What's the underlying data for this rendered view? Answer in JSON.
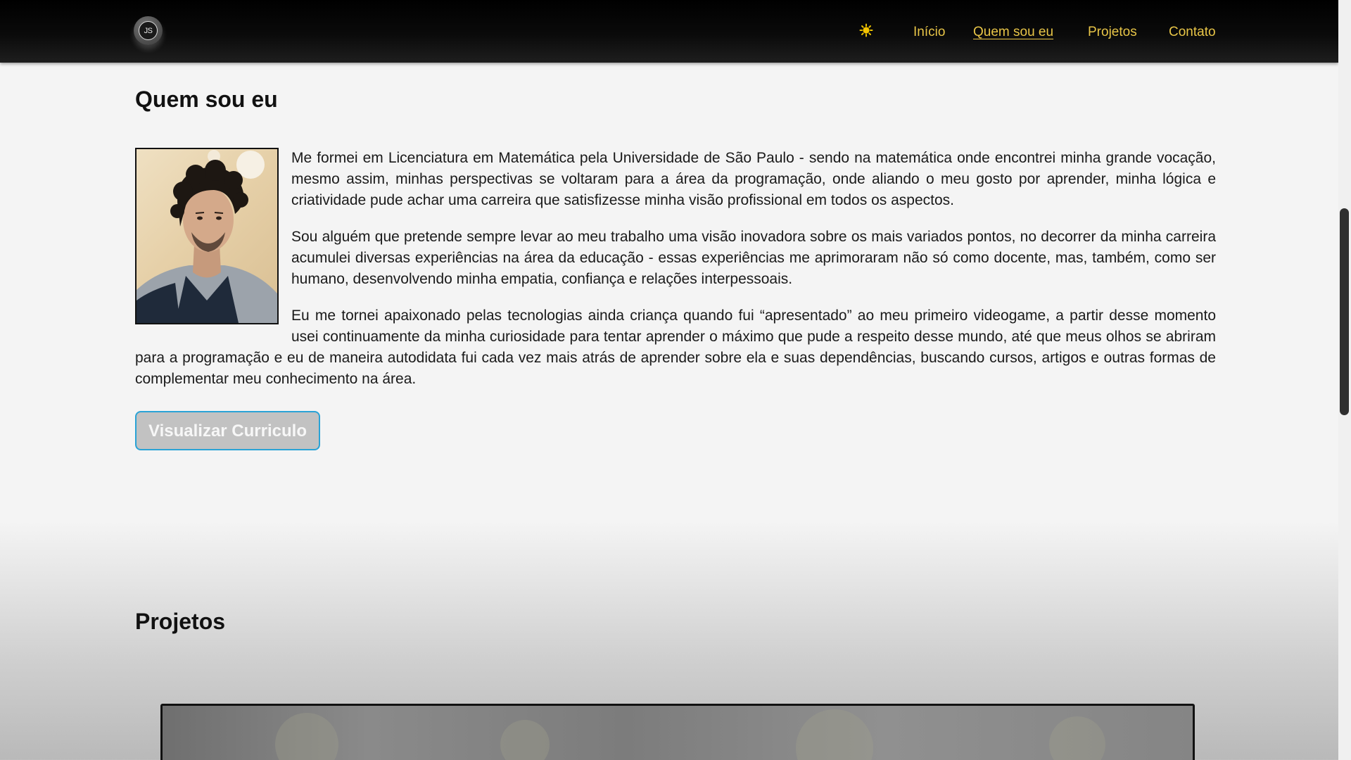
{
  "header": {
    "logo_text": "JS",
    "theme_icon": "sun-icon",
    "nav": [
      {
        "label": "Início",
        "active": false
      },
      {
        "label": "Quem sou eu",
        "active": true
      },
      {
        "label": "Projetos",
        "active": false
      },
      {
        "label": "Contato",
        "active": false
      }
    ],
    "accent_color": "#e8c547"
  },
  "about": {
    "title": "Quem sou eu",
    "paragraphs": [
      "Me formei em Licenciatura em Matemática pela Universidade de São Paulo - sendo na matemática onde encontrei minha grande vocação, mesmo assim, minhas perspectivas se voltaram para a área da programação, onde aliando o meu gosto por aprender, minha lógica e criatividade pude achar uma carreira que satisfizesse minha visão profissional em todos os aspectos.",
      "Sou alguém que pretende sempre levar ao meu trabalho uma visão inovadora sobre os mais variados pontos, no decorrer da minha carreira acumulei diversas experiências na área da educação - essas experiências me aprimoraram não só como docente, mas, também, como ser humano, desenvolvendo minha empatia, confiança e relações interpessoais.",
      "Eu me tornei apaixonado pelas tecnologias ainda criança quando fui “apresentado” ao meu primeiro videogame, a partir desse momento usei continuamente da minha curiosidade para tentar aprender o máximo que pude a respeito desse mundo, até que meus olhos se abriram para a programação e eu de maneira autodidata fui cada vez mais atrás de aprender sobre ela e suas dependências, buscando cursos, artigos e outras formas de complementar meu conhecimento na área."
    ],
    "cv_button_label": "Visualizar Curriculo",
    "cv_button_border_color": "#2aa3d6"
  },
  "projects": {
    "title": "Projetos"
  }
}
